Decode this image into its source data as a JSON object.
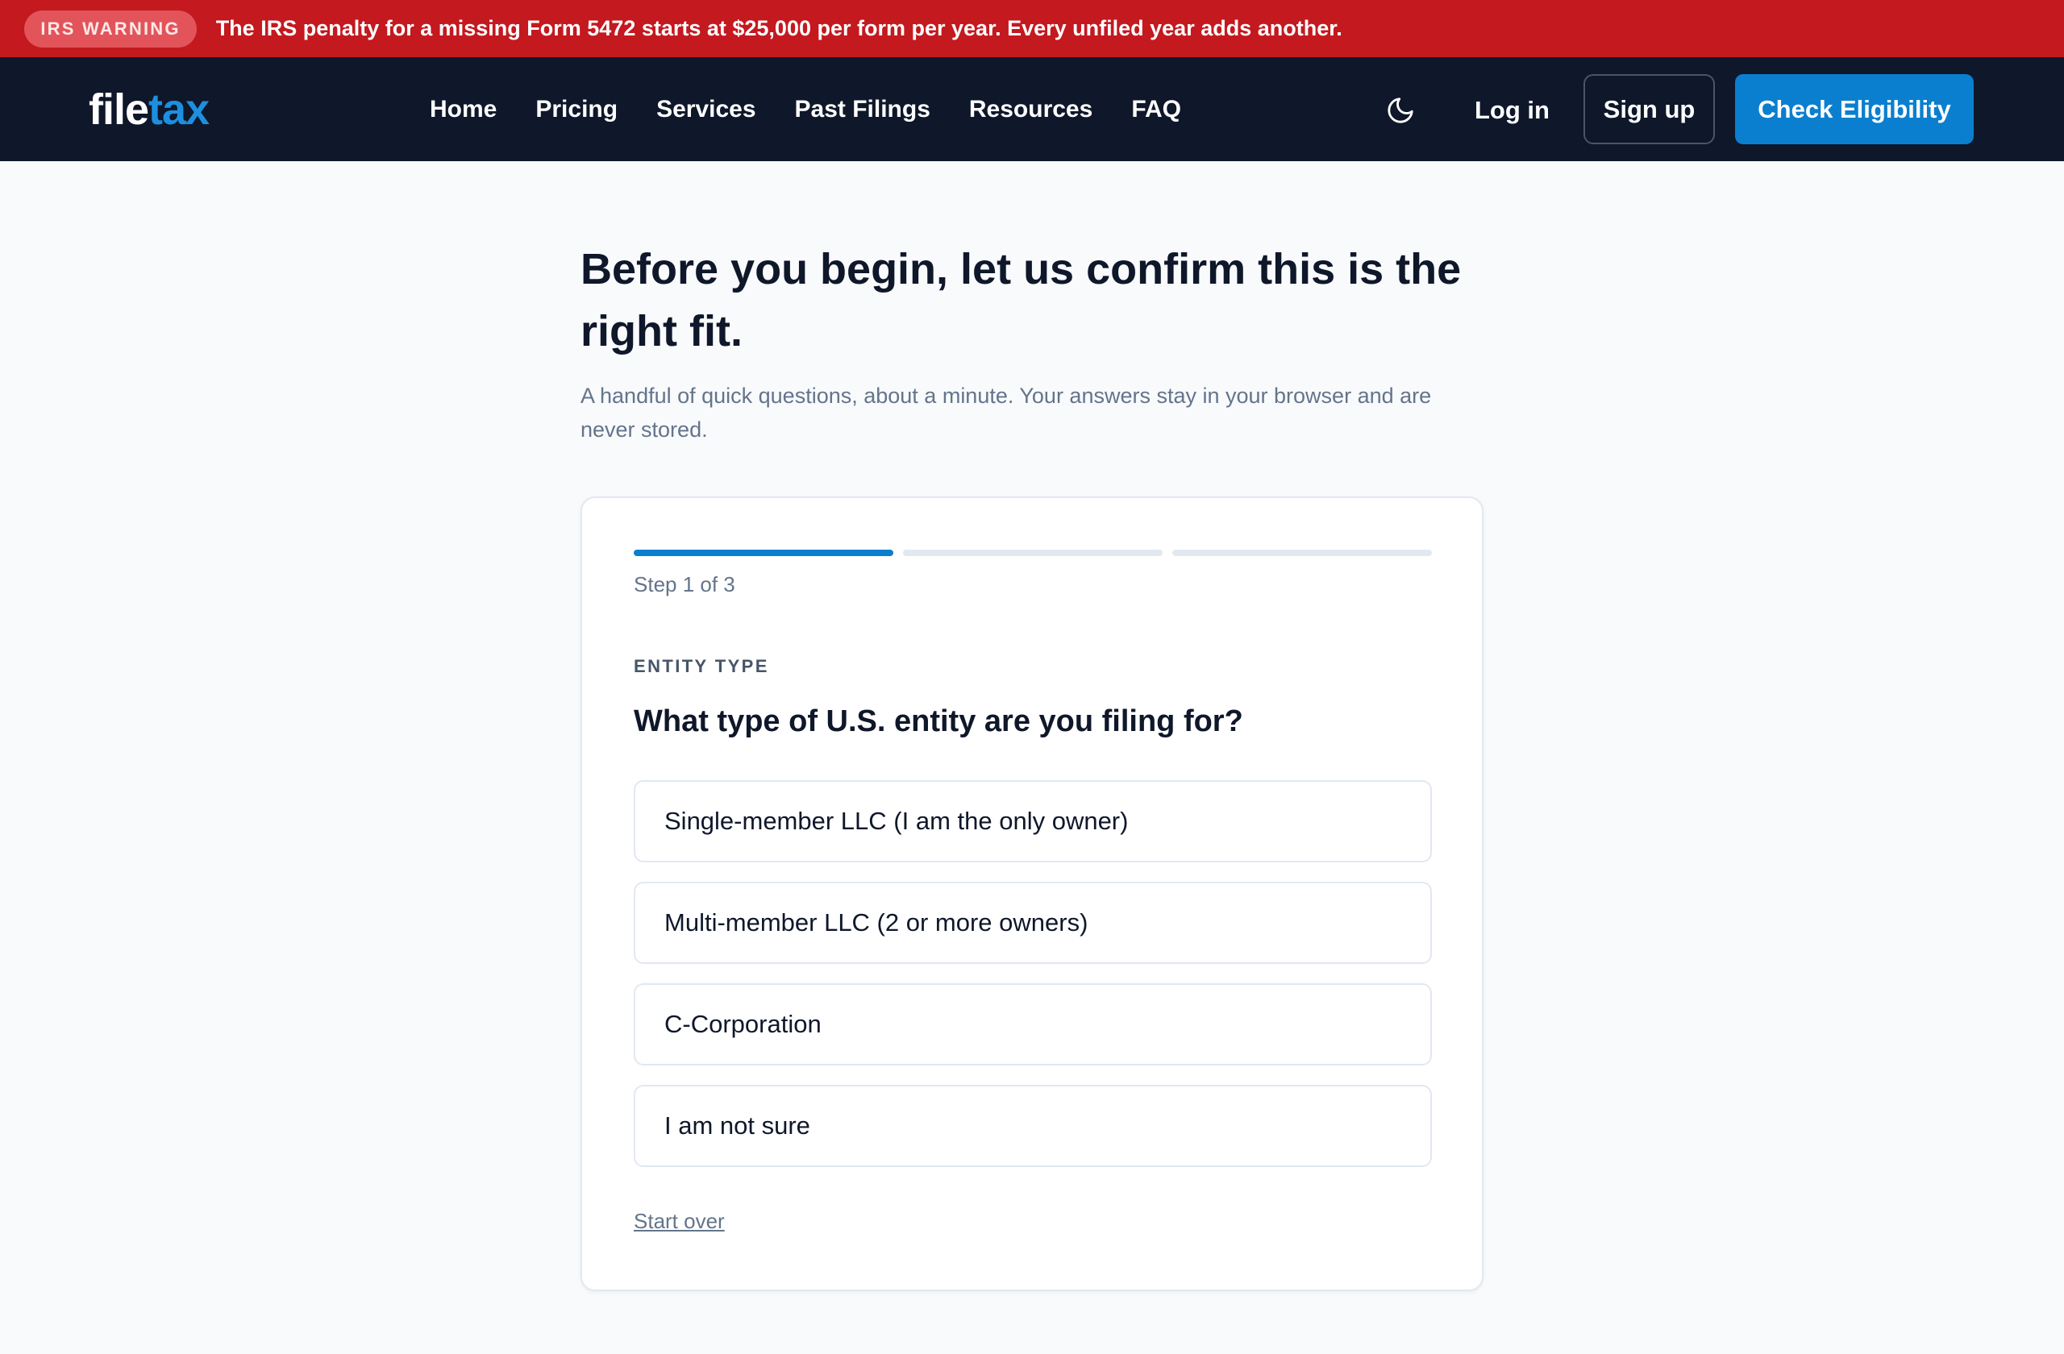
{
  "ticker": {
    "badge": "IRS WARNING",
    "message": "The IRS penalty for a missing Form 5472 starts at $25,000 per form per year. Every unfiled year adds another.",
    "bg_color": "#c3191f"
  },
  "nav": {
    "logo_part1": "file",
    "logo_part2": "tax",
    "links": [
      "Home",
      "Pricing",
      "Services",
      "Past Filings",
      "Resources",
      "FAQ"
    ],
    "theme_icon": "moon-icon",
    "login": "Log in",
    "signup": "Sign up",
    "cta": "Check Eligibility",
    "accent_color": "#0a7fcf"
  },
  "hero": {
    "title": "Before you begin, let us confirm this is the right fit.",
    "subtitle": "A handful of quick questions, about a minute. Your answers stay in your browser and are never stored."
  },
  "wizard": {
    "current_step": 1,
    "total_steps": 3,
    "step_label": "Step 1 of 3",
    "eyebrow": "ENTITY TYPE",
    "question": "What type of U.S. entity are you filing for?",
    "options": [
      "Single-member LLC (I am the only owner)",
      "Multi-member LLC (2 or more owners)",
      "C-Corporation",
      "I am not sure"
    ],
    "start_over": "Start over"
  }
}
